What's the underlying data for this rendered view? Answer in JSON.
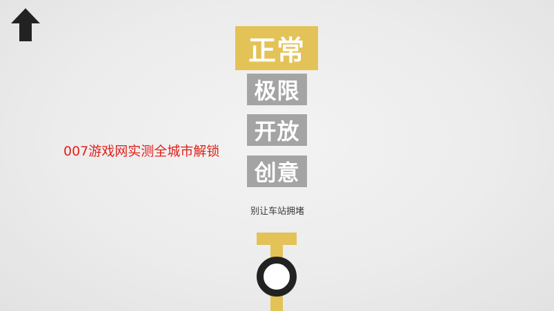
{
  "navigation": {
    "back_icon": "up-arrow-icon"
  },
  "modes": [
    {
      "label": "正常",
      "selected": true
    },
    {
      "label": "极限",
      "selected": false
    },
    {
      "label": "开放",
      "selected": false
    },
    {
      "label": "创意",
      "selected": false
    }
  ],
  "subtitle": "别让车站拥堵",
  "watermark": "007游戏网实测全城市解锁",
  "colors": {
    "selected": "#e3c257",
    "unselected": "#a4a4a4",
    "line": "#e3c257",
    "station_ring": "#222222",
    "watermark": "#e0201a"
  },
  "station": {
    "icon": "metro-line-station-icon"
  }
}
